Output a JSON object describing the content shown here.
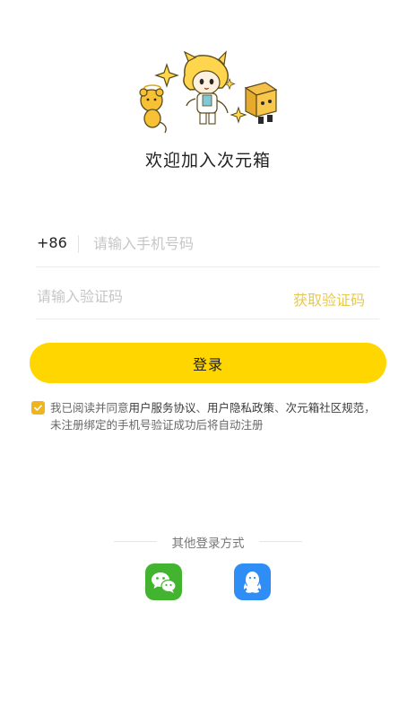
{
  "header": {
    "welcome_text": "欢迎加入次元箱"
  },
  "phone": {
    "country_code": "+86",
    "placeholder": "请输入手机号码",
    "value": ""
  },
  "code": {
    "placeholder": "请输入验证码",
    "value": "",
    "get_code_label": "获取验证码"
  },
  "login_button": {
    "label": "登录"
  },
  "agreement": {
    "checked": true,
    "prefix": "我已阅读并同意",
    "link_service": "用户服务协议",
    "sep1": "、",
    "link_privacy": "用户隐私政策",
    "sep2": "、",
    "link_community": "次元箱社区规范",
    "suffix": "，未注册绑定的手机号验证成功后将自动注册"
  },
  "other_login": {
    "title": "其他登录方式",
    "options": [
      {
        "name": "wechat",
        "icon": "wechat-icon",
        "color": "#43b430"
      },
      {
        "name": "qq",
        "icon": "qq-icon",
        "color": "#2e8ef5"
      }
    ]
  },
  "colors": {
    "accent": "#ffd600",
    "checkbox": "#f0b41f",
    "get_code": "#e8c94f"
  }
}
